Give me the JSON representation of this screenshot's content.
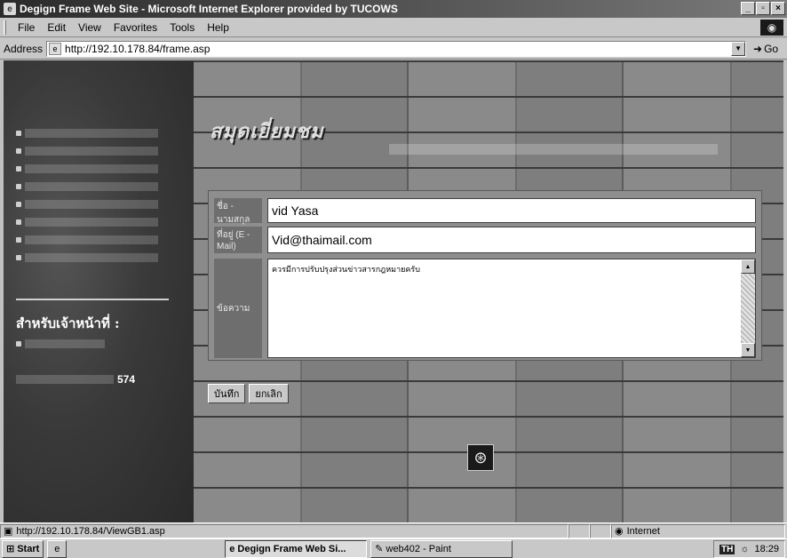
{
  "window": {
    "title": "Degign Frame Web Site - Microsoft Internet Explorer provided by TUCOWS",
    "minimize": "_",
    "maximize": "▫",
    "close": "×"
  },
  "menubar": {
    "items": [
      "File",
      "Edit",
      "View",
      "Favorites",
      "Tools",
      "Help"
    ]
  },
  "addressbar": {
    "label": "Address",
    "url": "http://192.10.178.84/frame.asp",
    "go_label": "Go"
  },
  "sidebar": {
    "heading": "สำหรับเจ้าหน้าที่ :",
    "visitors_count": "574"
  },
  "form": {
    "name_label": "ชื่อ - นามสกุล",
    "name_value": "vid Yasa",
    "email_label": "ที่อยู่ (E - Mail)",
    "email_value": "Vid@thaimail.com",
    "message_label": "ข้อความ",
    "message_value": "ควรมีการปรับปรุงส่วนข่าวสารกฎหมายครับ",
    "save_button": "บันทึก",
    "cancel_button": "ยกเลิก"
  },
  "statusbar": {
    "url": "http://192.10.178.84/ViewGB1.asp",
    "zone": "Internet"
  },
  "taskbar": {
    "start": "Start",
    "task1": "Degign Frame Web Si...",
    "task2": "web402 - Paint",
    "clock": "18:29",
    "lang": "TH"
  }
}
